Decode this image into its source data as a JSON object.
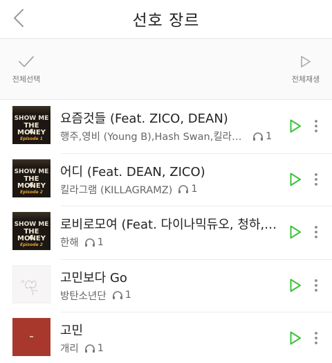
{
  "header": {
    "title": "선호 장르"
  },
  "toolbar": {
    "select_all_label": "전체선택",
    "play_all_label": "전체재생"
  },
  "colors": {
    "accent": "#3cc13c",
    "icon_gray": "#aaaaaa"
  },
  "songs": [
    {
      "title": "요즘것들 (Feat. ZICO, DEAN)",
      "artist": "행주,영비 (Young B),Hash Swan,킬라그램 (KILLAGRAMZ)",
      "count": "1",
      "cover": {
        "logo1": "SHOW ME",
        "logo2": "THE MONEY",
        "num": "6",
        "episode": "Episode 1"
      }
    },
    {
      "title": "어디 (Feat. DEAN, ZICO)",
      "artist": "킬라그램 (KILLAGRAMZ)",
      "count": "1",
      "cover": {
        "logo1": "SHOW ME",
        "logo2": "THE MONEY",
        "num": "6",
        "episode": "Episode 2"
      }
    },
    {
      "title": "로비로모여 (Feat. 다이나믹듀오, 청하, 박재범)",
      "artist": "한해",
      "count": "1",
      "cover": {
        "logo1": "SHOW ME",
        "logo2": "THE MONEY",
        "num": "6",
        "episode": "Episode 2"
      }
    },
    {
      "title": "고민보다 Go",
      "artist": "방탄소년단",
      "count": "1",
      "cover": {}
    },
    {
      "title": "고민",
      "artist": "개리",
      "count": "1",
      "cover": {}
    }
  ]
}
